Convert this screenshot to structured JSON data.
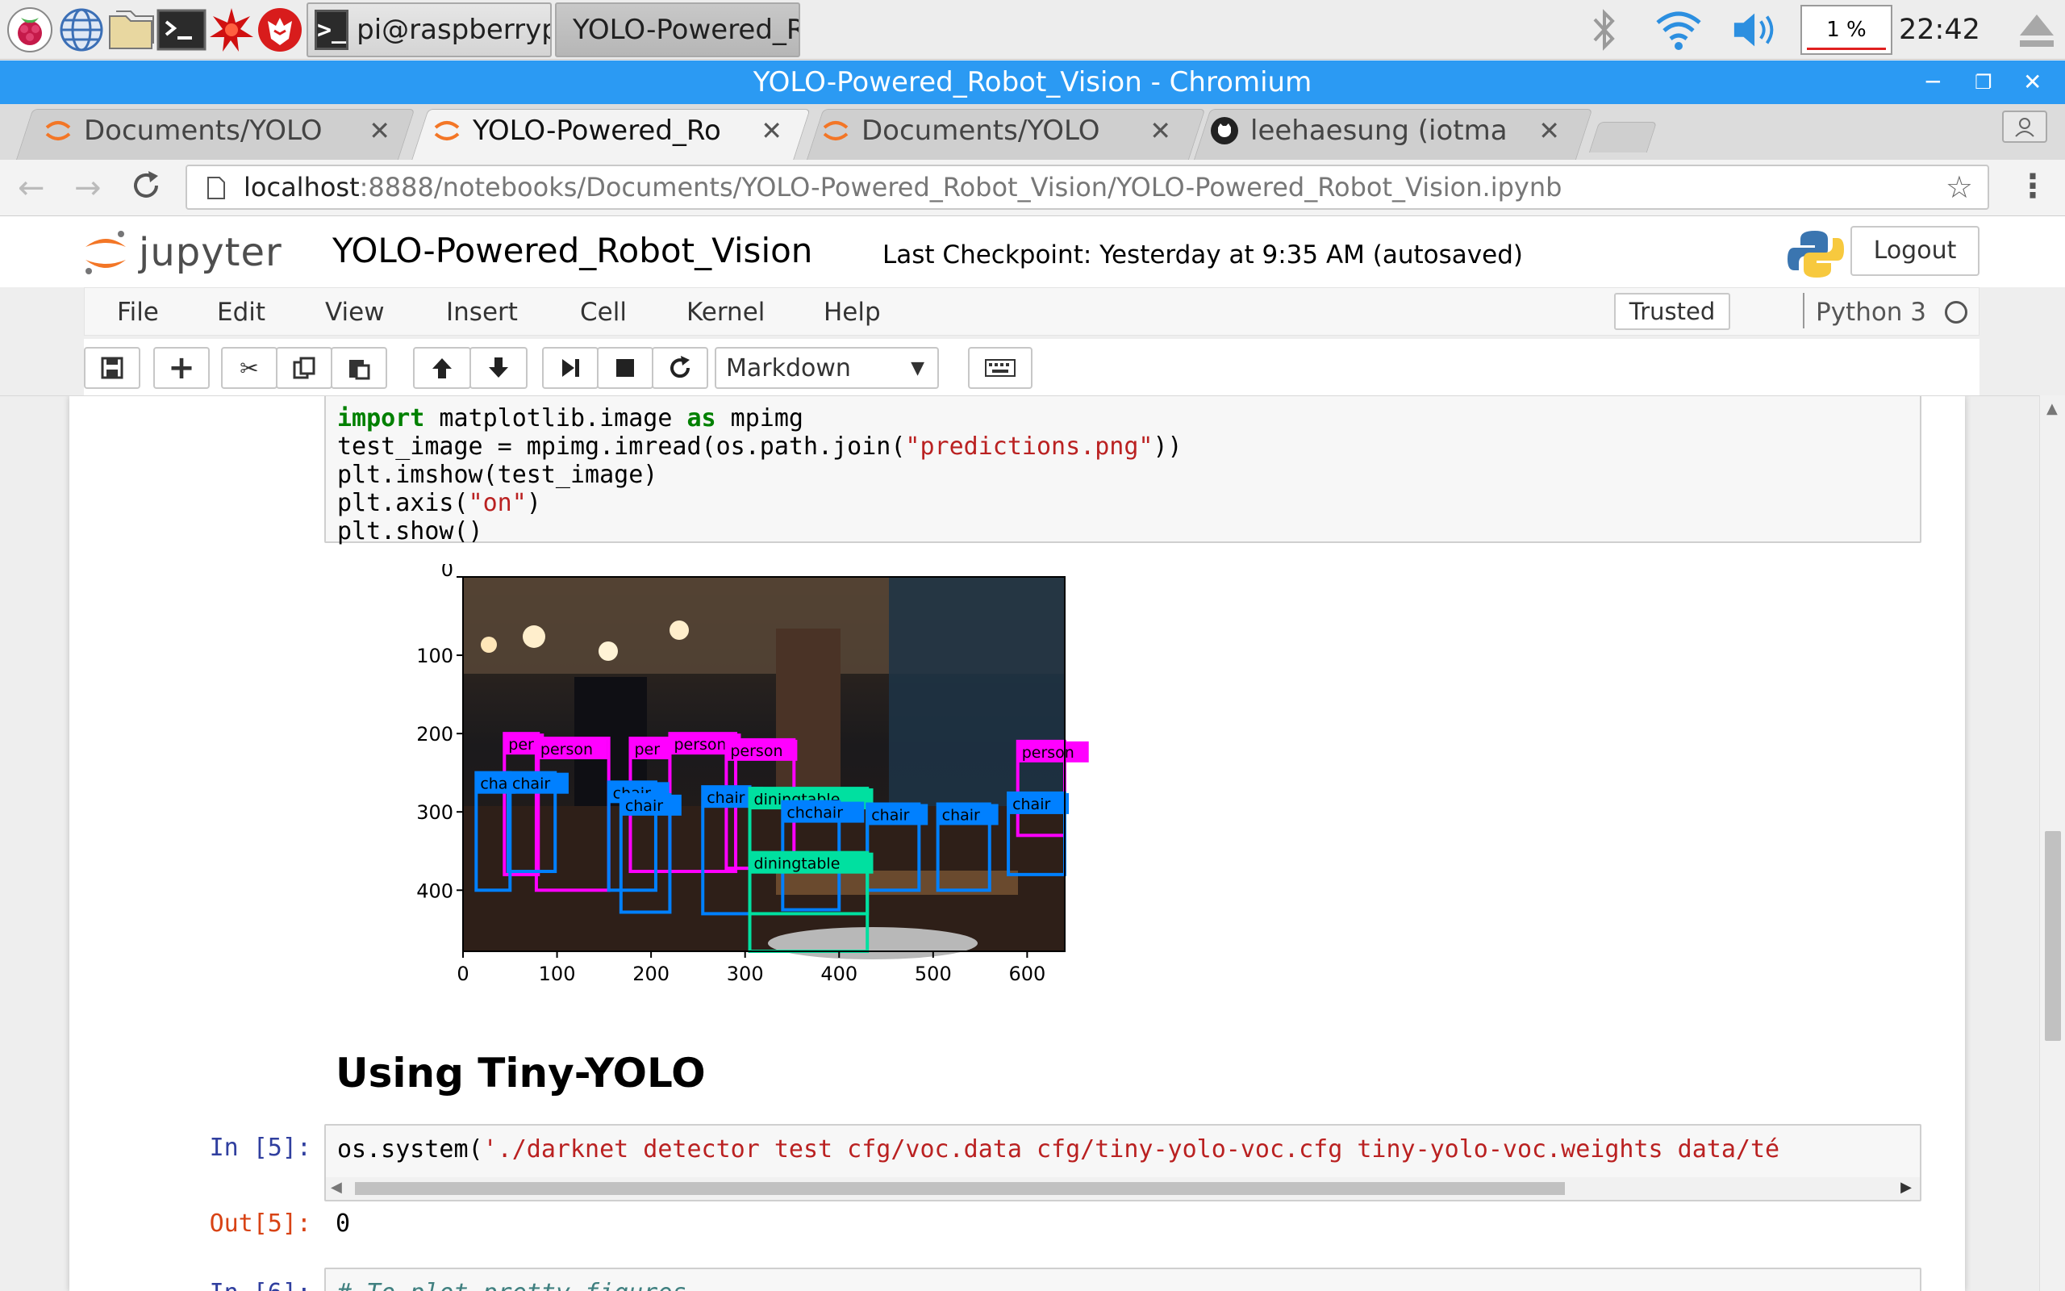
{
  "taskbar": {
    "windows": [
      {
        "label": "pi@raspberrypi: ~"
      },
      {
        "label": "YOLO-Powered_Rob..."
      }
    ],
    "cpu": "1 %",
    "clock": "22:42"
  },
  "browser": {
    "window_title": "YOLO-Powered_Robot_Vision - Chromium",
    "tabs": [
      {
        "label": "Documents/YOLO"
      },
      {
        "label": "YOLO-Powered_Ro"
      },
      {
        "label": "Documents/YOLO"
      },
      {
        "label": "leehaesung (iotma"
      }
    ],
    "url_host": "localhost",
    "url_rest": ":8888/notebooks/Documents/YOLO-Powered_Robot_Vision/YOLO-Powered_Robot_Vision.ipynb"
  },
  "notebook": {
    "logo_text": "jupyter",
    "title": "YOLO-Powered_Robot_Vision",
    "checkpoint": "Last Checkpoint: Yesterday at 9:35 AM (autosaved)",
    "logout": "Logout",
    "menu": [
      "File",
      "Edit",
      "View",
      "Insert",
      "Cell",
      "Kernel",
      "Help"
    ],
    "trusted": "Trusted",
    "kernel": "Python 3",
    "cell_type": "Markdown",
    "code_cell_1": {
      "line1_kw1": "import",
      "line1_mid": " matplotlib.image ",
      "line1_kw2": "as",
      "line1_end": " mpimg",
      "line2_pre": "test_image = mpimg.imread(os.path.join(",
      "line2_str": "\"predictions.png\"",
      "line2_post": "))",
      "line3": "plt.imshow(test_image)",
      "line4_pre": "plt.axis(",
      "line4_str": "\"on\"",
      "line4_post": ")",
      "line5": "plt.show()"
    },
    "heading": "Using Tiny-YOLO",
    "cell5": {
      "in_prompt": "In [5]:",
      "code_pre": "os.system(",
      "code_str": "'./darknet detector test cfg/voc.data cfg/tiny-yolo-voc.cfg tiny-yolo-voc.weights data/té",
      "out_prompt": "Out[5]:",
      "out_value": "0"
    },
    "cell6": {
      "in_prompt": "In [6]:",
      "code": "# To plot pretty figures"
    }
  },
  "plot": {
    "x_ticks": [
      "0",
      "100",
      "200",
      "300",
      "400",
      "500",
      "600"
    ],
    "y_ticks": [
      "0",
      "100",
      "200",
      "300",
      "400"
    ],
    "detections": [
      {
        "label": "per",
        "color": "#ff00ff"
      },
      {
        "label": "person",
        "color": "#ff00ff"
      },
      {
        "label": "per",
        "color": "#ff00ff"
      },
      {
        "label": "person",
        "color": "#ff00ff"
      },
      {
        "label": "person",
        "color": "#ff00ff"
      },
      {
        "label": "person",
        "color": "#ff00ff"
      },
      {
        "label": "cha",
        "color": "#0080ff"
      },
      {
        "label": "chair",
        "color": "#0080ff"
      },
      {
        "label": "chair",
        "color": "#0080ff"
      },
      {
        "label": "chair",
        "color": "#0080ff"
      },
      {
        "label": "chair",
        "color": "#0080ff"
      },
      {
        "label": "diningtable",
        "color": "#00e0a0"
      },
      {
        "label": "chchair",
        "color": "#0080ff"
      },
      {
        "label": "chair",
        "color": "#0080ff"
      },
      {
        "label": "chair",
        "color": "#0080ff"
      },
      {
        "label": "chair",
        "color": "#0080ff"
      },
      {
        "label": "diningtable",
        "color": "#00e0a0"
      }
    ]
  }
}
